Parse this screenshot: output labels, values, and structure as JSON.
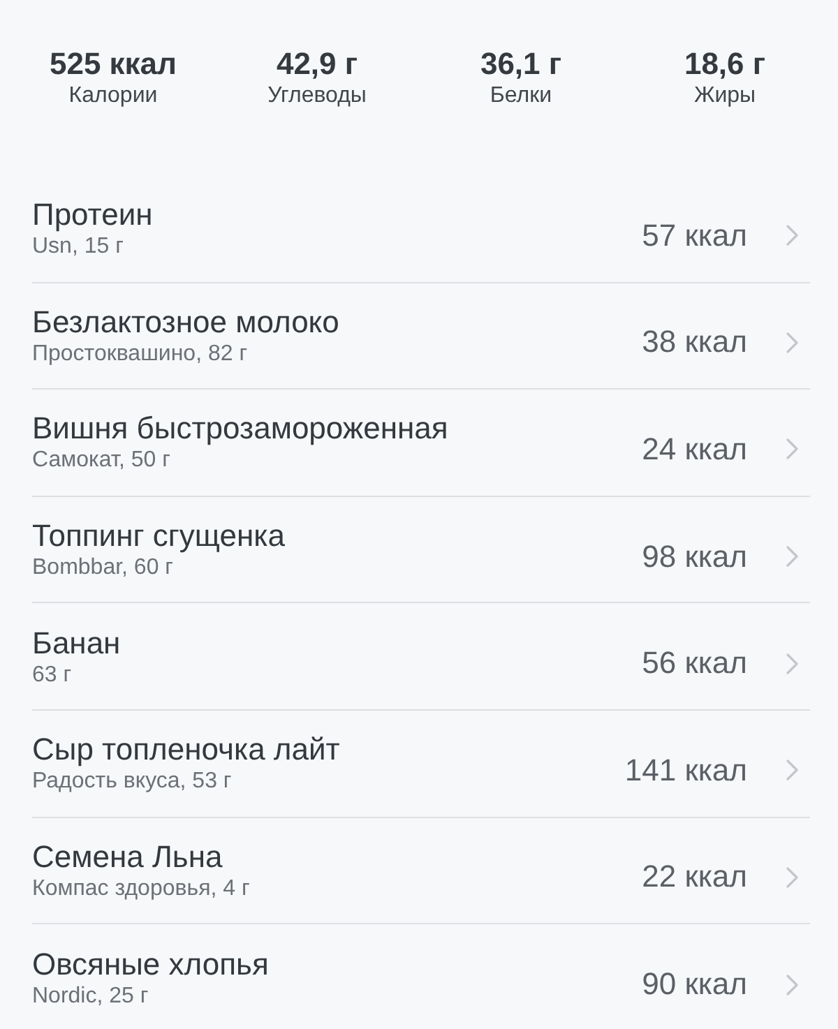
{
  "summary": [
    {
      "value": "525 ккал",
      "label": "Калории"
    },
    {
      "value": "42,9 г",
      "label": "Углеводы"
    },
    {
      "value": "36,1 г",
      "label": "Белки"
    },
    {
      "value": "18,6 г",
      "label": "Жиры"
    }
  ],
  "items": [
    {
      "name": "Протеин",
      "detail": "Usn, 15 г",
      "calories": "57 ккал"
    },
    {
      "name": "Безлактозное молоко",
      "detail": "Простоквашино, 82 г",
      "calories": "38 ккал"
    },
    {
      "name": "Вишня быстрозамороженная",
      "detail": "Самокат, 50 г",
      "calories": "24 ккал"
    },
    {
      "name": "Топпинг сгущенка",
      "detail": "Bombbar, 60 г",
      "calories": "98 ккал"
    },
    {
      "name": "Банан",
      "detail": "63 г",
      "calories": "56 ккал"
    },
    {
      "name": "Сыр топленочка лайт",
      "detail": "Радость вкуса, 53 г",
      "calories": "141 ккал"
    },
    {
      "name": "Семена Льна",
      "detail": "Компас здоровья, 4 г",
      "calories": "22 ккал"
    },
    {
      "name": "Овсяные хлопья",
      "detail": "Nordic, 25 г",
      "calories": "90 ккал"
    }
  ]
}
